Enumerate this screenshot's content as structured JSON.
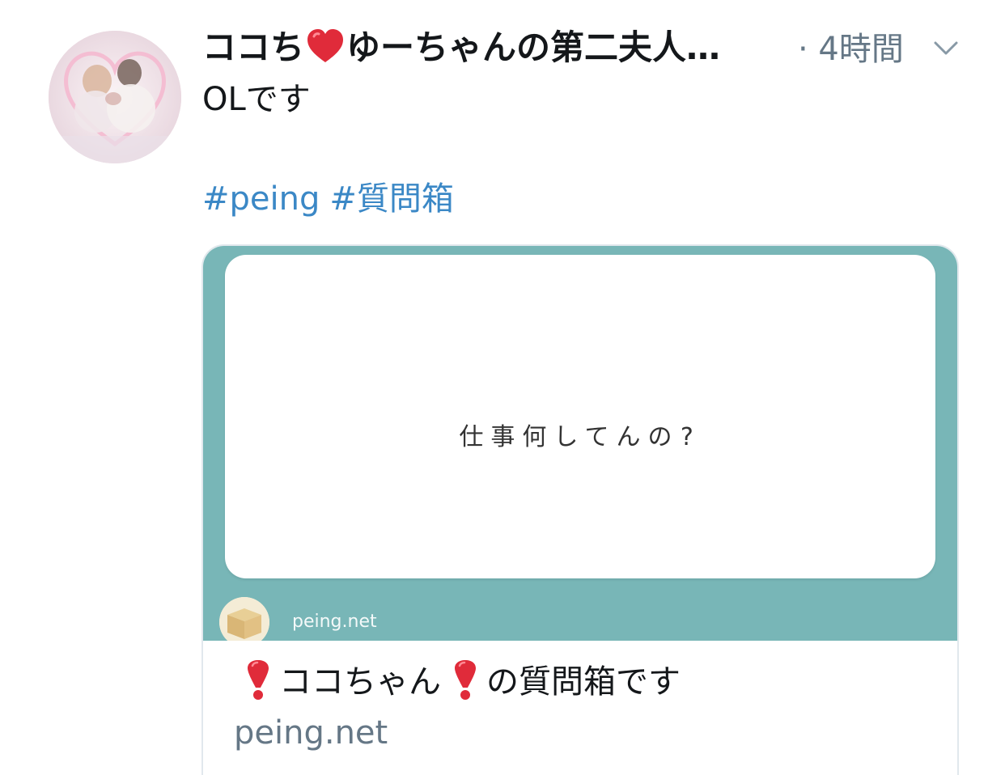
{
  "tweet": {
    "display_name_part1": "ココち",
    "display_name_part2": "ゆーちゃんの第二夫人…",
    "timestamp": "· 4時間",
    "text": "OLです",
    "hashtags": [
      "#peing",
      "#質問箱"
    ]
  },
  "card": {
    "question": "仕事何してんの?",
    "site_name": "peing.net",
    "title_part1": "ココちゃん",
    "title_part2": "の質問箱です",
    "domain": "peing.net"
  },
  "colors": {
    "hashtag": "#3b88c6",
    "card_bg": "#78b6b7",
    "secondary_text": "#657786",
    "heart": "#e02b3a"
  },
  "icons": {
    "heart": "red-heart-icon",
    "exclamation": "red-exclamation-icon",
    "caret": "chevron-down-icon"
  }
}
